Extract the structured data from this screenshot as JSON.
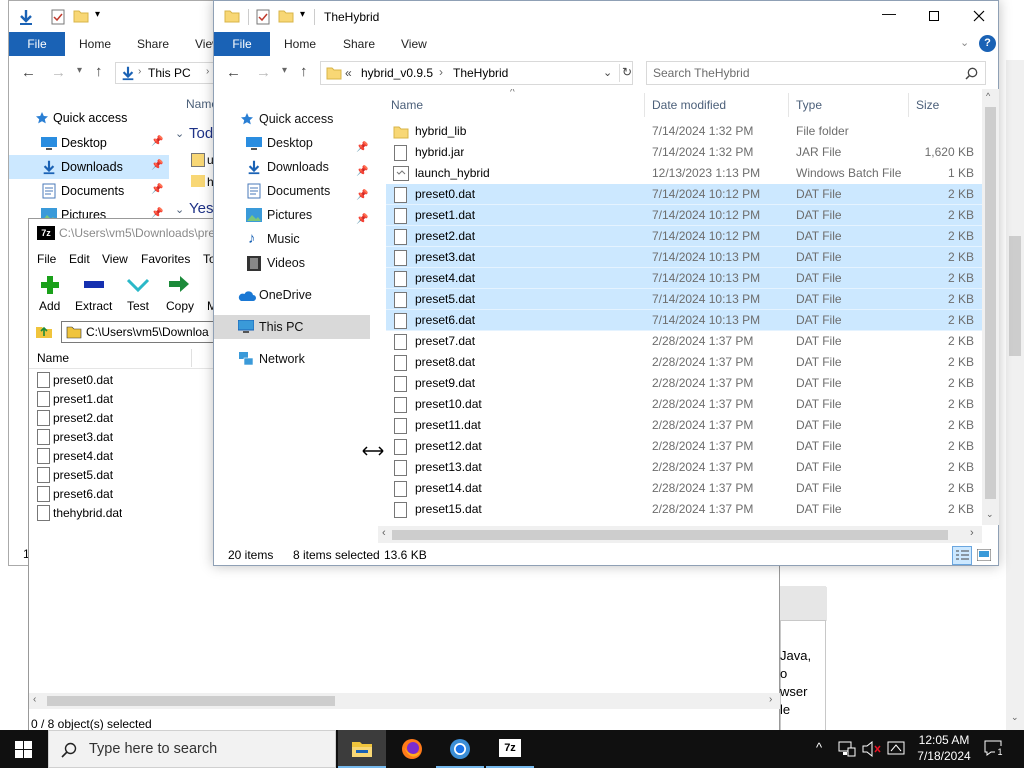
{
  "back_window": {
    "ribbon_tabs": [
      "File",
      "Home",
      "Share",
      "View"
    ],
    "address": "This PC",
    "col_name": "Name",
    "groups": [
      "Tod",
      "Yest"
    ],
    "nav": [
      "Quick access",
      "Desktop",
      "Downloads",
      "Documents",
      "Pictures"
    ],
    "status": "1"
  },
  "sevenzip": {
    "title": "C:\\Users\\vm5\\Downloads\\pre",
    "menu": [
      "File",
      "Edit",
      "View",
      "Favorites",
      "To"
    ],
    "toolbar": [
      "Add",
      "Extract",
      "Test",
      "Copy",
      "M"
    ],
    "path": "C:\\Users\\vm5\\Downloa",
    "col_name": "Name",
    "files": [
      "preset0.dat",
      "preset1.dat",
      "preset2.dat",
      "preset3.dat",
      "preset4.dat",
      "preset5.dat",
      "preset6.dat",
      "thehybrid.dat"
    ],
    "status": "0 / 8 object(s) selected",
    "side_text": [
      "Java,",
      "o",
      "wser",
      "le"
    ]
  },
  "explorer": {
    "title": "TheHybrid",
    "ribbon_tabs": [
      "File",
      "Home",
      "Share",
      "View"
    ],
    "breadcrumb": [
      "«",
      "hybrid_v0.9.5",
      "›",
      "TheHybrid"
    ],
    "search_placeholder": "Search TheHybrid",
    "columns": [
      "Name",
      "Date modified",
      "Type",
      "Size"
    ],
    "nav": {
      "quick_access": "Quick access",
      "desktop": "Desktop",
      "downloads": "Downloads",
      "documents": "Documents",
      "pictures": "Pictures",
      "music": "Music",
      "videos": "Videos",
      "onedrive": "OneDrive",
      "this_pc": "This PC",
      "network": "Network"
    },
    "files": [
      {
        "name": "hybrid_lib",
        "date": "7/14/2024 1:32 PM",
        "type": "File folder",
        "size": "",
        "kind": "folder",
        "selected": false
      },
      {
        "name": "hybrid.jar",
        "date": "7/14/2024 1:32 PM",
        "type": "JAR File",
        "size": "1,620 KB",
        "kind": "file",
        "selected": false
      },
      {
        "name": "launch_hybrid",
        "date": "12/13/2023 1:13 PM",
        "type": "Windows Batch File",
        "size": "1 KB",
        "kind": "bat",
        "selected": false
      },
      {
        "name": "preset0.dat",
        "date": "7/14/2024 10:12 PM",
        "type": "DAT File",
        "size": "2 KB",
        "kind": "file",
        "selected": true
      },
      {
        "name": "preset1.dat",
        "date": "7/14/2024 10:12 PM",
        "type": "DAT File",
        "size": "2 KB",
        "kind": "file",
        "selected": true
      },
      {
        "name": "preset2.dat",
        "date": "7/14/2024 10:12 PM",
        "type": "DAT File",
        "size": "2 KB",
        "kind": "file",
        "selected": true
      },
      {
        "name": "preset3.dat",
        "date": "7/14/2024 10:13 PM",
        "type": "DAT File",
        "size": "2 KB",
        "kind": "file",
        "selected": true
      },
      {
        "name": "preset4.dat",
        "date": "7/14/2024 10:13 PM",
        "type": "DAT File",
        "size": "2 KB",
        "kind": "file",
        "selected": true
      },
      {
        "name": "preset5.dat",
        "date": "7/14/2024 10:13 PM",
        "type": "DAT File",
        "size": "2 KB",
        "kind": "file",
        "selected": true
      },
      {
        "name": "preset6.dat",
        "date": "7/14/2024 10:13 PM",
        "type": "DAT File",
        "size": "2 KB",
        "kind": "file",
        "selected": true
      },
      {
        "name": "preset7.dat",
        "date": "2/28/2024 1:37 PM",
        "type": "DAT File",
        "size": "2 KB",
        "kind": "file",
        "selected": false
      },
      {
        "name": "preset8.dat",
        "date": "2/28/2024 1:37 PM",
        "type": "DAT File",
        "size": "2 KB",
        "kind": "file",
        "selected": false
      },
      {
        "name": "preset9.dat",
        "date": "2/28/2024 1:37 PM",
        "type": "DAT File",
        "size": "2 KB",
        "kind": "file",
        "selected": false
      },
      {
        "name": "preset10.dat",
        "date": "2/28/2024 1:37 PM",
        "type": "DAT File",
        "size": "2 KB",
        "kind": "file",
        "selected": false
      },
      {
        "name": "preset11.dat",
        "date": "2/28/2024 1:37 PM",
        "type": "DAT File",
        "size": "2 KB",
        "kind": "file",
        "selected": false
      },
      {
        "name": "preset12.dat",
        "date": "2/28/2024 1:37 PM",
        "type": "DAT File",
        "size": "2 KB",
        "kind": "file",
        "selected": false
      },
      {
        "name": "preset13.dat",
        "date": "2/28/2024 1:37 PM",
        "type": "DAT File",
        "size": "2 KB",
        "kind": "file",
        "selected": false
      },
      {
        "name": "preset14.dat",
        "date": "2/28/2024 1:37 PM",
        "type": "DAT File",
        "size": "2 KB",
        "kind": "file",
        "selected": false
      },
      {
        "name": "preset15.dat",
        "date": "2/28/2024 1:37 PM",
        "type": "DAT File",
        "size": "2 KB",
        "kind": "file",
        "selected": false
      }
    ],
    "status_items": "20 items",
    "status_selected": "8 items selected",
    "status_size": "13.6 KB",
    "accent": "#1a62b5",
    "selection_color": "#cce8ff"
  },
  "taskbar": {
    "search_placeholder": "Type here to search",
    "time": "12:05 AM",
    "date": "7/18/2024",
    "notification_count": "1",
    "apps": [
      "file-explorer-icon",
      "firefox-icon",
      "chrome-icon",
      "7zip-icon"
    ]
  }
}
